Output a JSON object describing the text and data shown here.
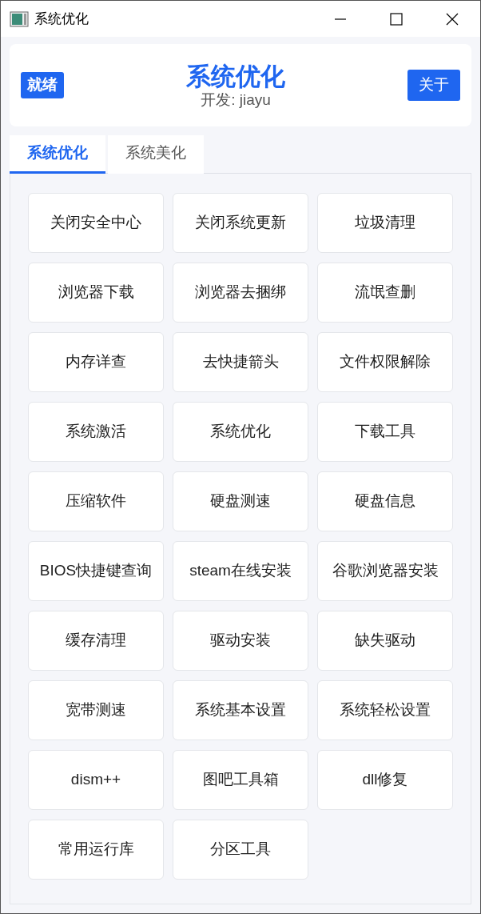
{
  "window": {
    "title": "系统优化"
  },
  "header": {
    "status": "就绪",
    "title": "系统优化",
    "subtitle": "开发: jiayu",
    "about_button": "关于"
  },
  "tabs": [
    {
      "label": "系统优化",
      "selected": true
    },
    {
      "label": "系统美化",
      "selected": false
    }
  ],
  "tools": [
    "关闭安全中心",
    "关闭系统更新",
    "垃圾清理",
    "浏览器下载",
    "浏览器去捆绑",
    "流氓查删",
    "内存详查",
    "去快捷箭头",
    "文件权限解除",
    "系统激活",
    "系统优化",
    "下载工具",
    "压缩软件",
    "硬盘测速",
    "硬盘信息",
    "BIOS快捷键查询",
    "steam在线安装",
    "谷歌浏览器安装",
    "缓存清理",
    "驱动安装",
    "缺失驱动",
    "宽带测速",
    "系统基本设置",
    "系统轻松设置",
    "dism++",
    "图吧工具箱",
    "dll修复",
    "常用运行库",
    "分区工具"
  ]
}
